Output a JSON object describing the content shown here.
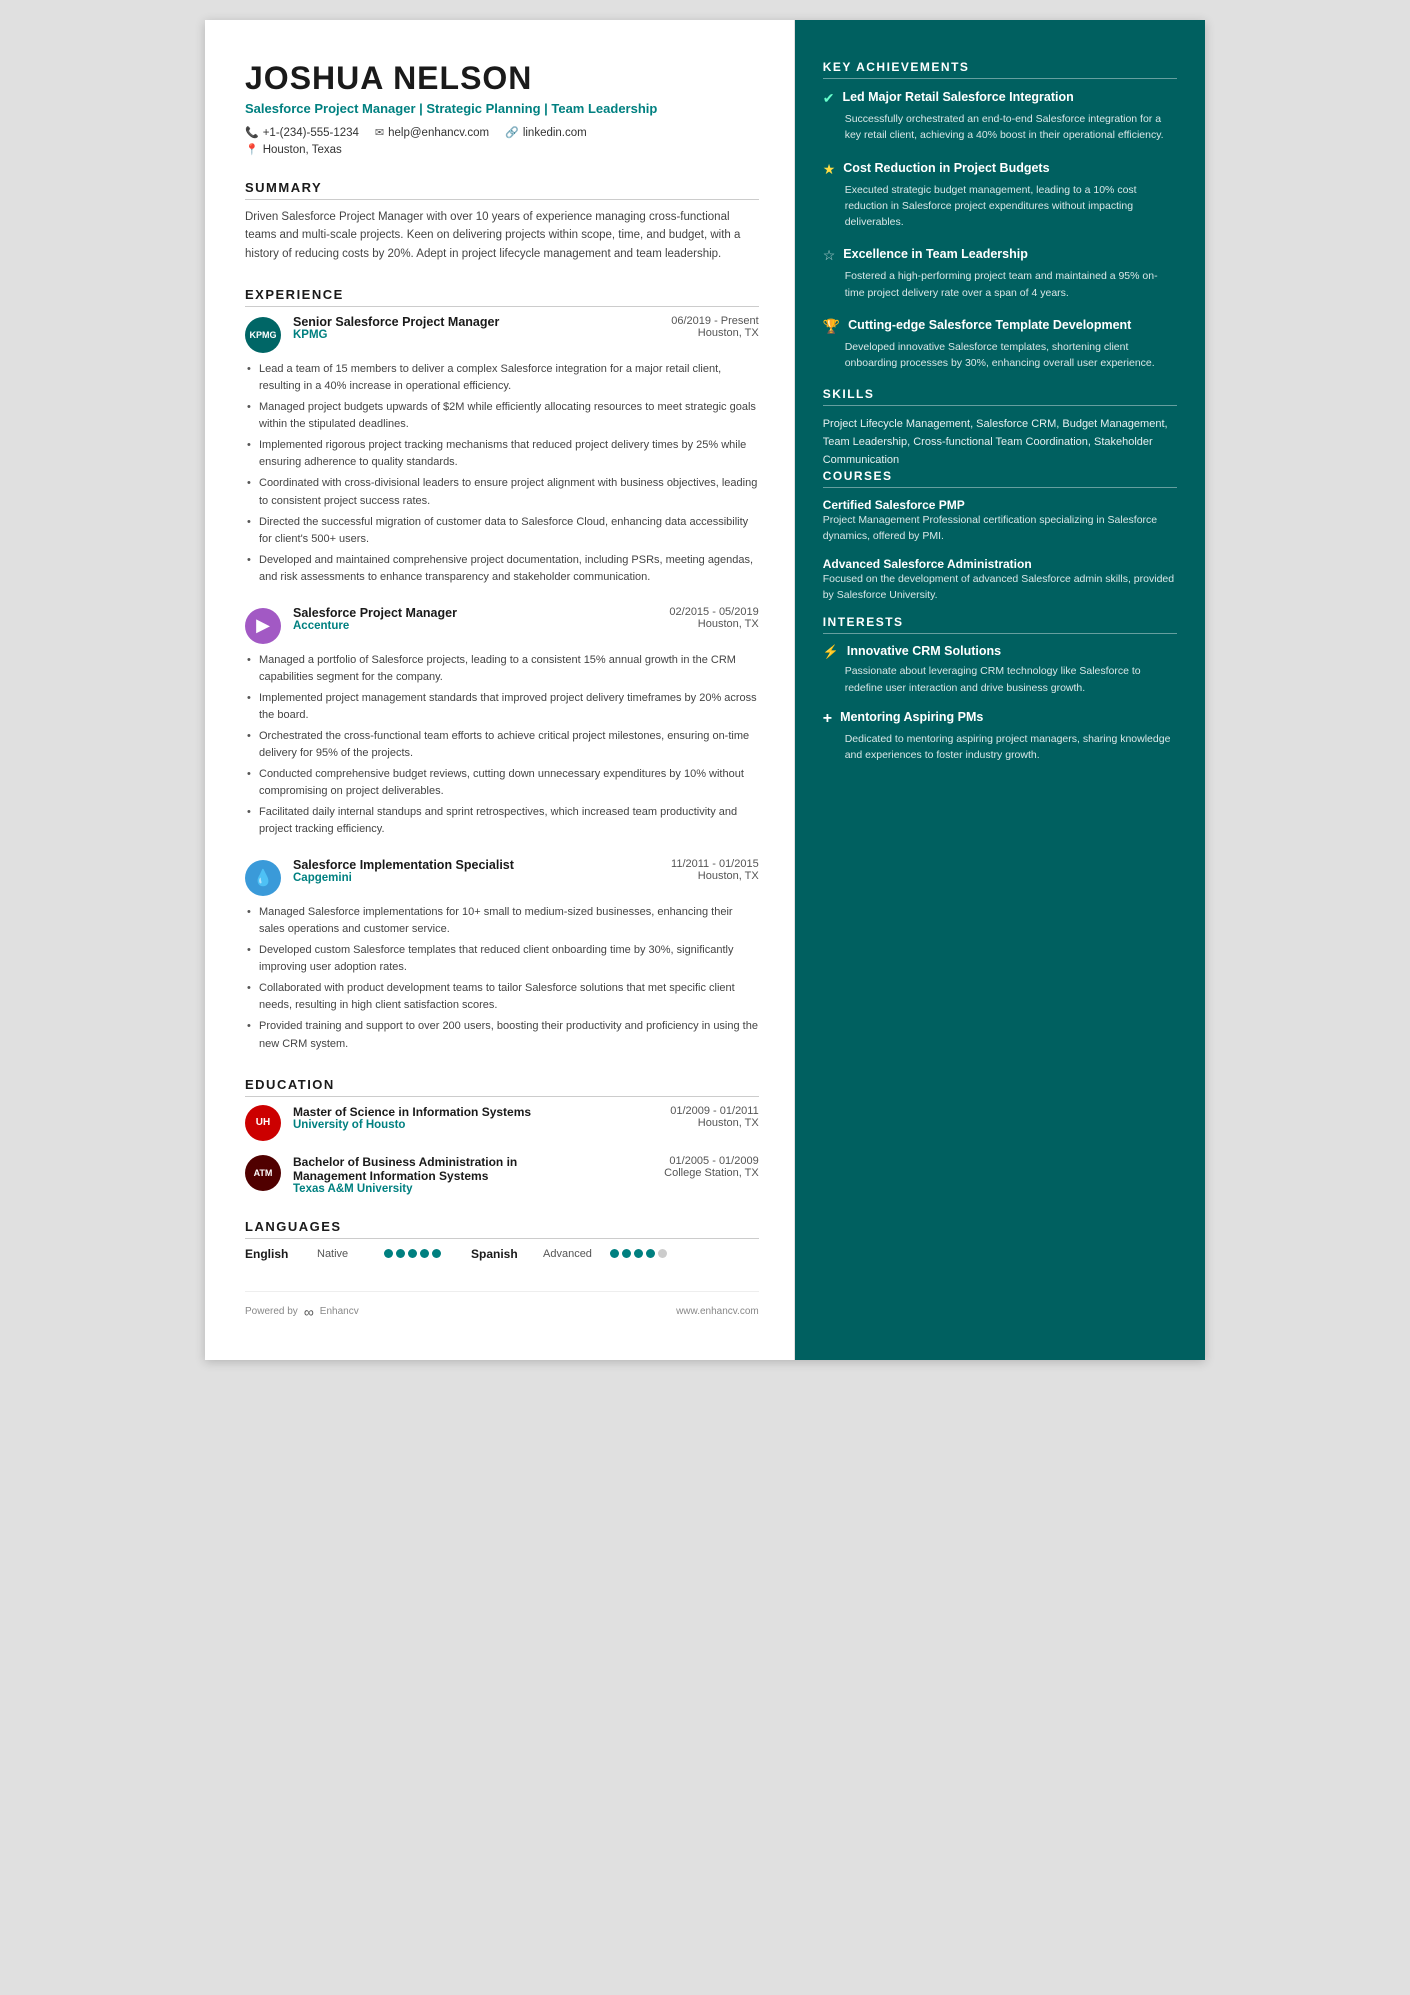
{
  "header": {
    "name": "JOSHUA NELSON",
    "title": "Salesforce Project Manager | Strategic Planning | Team Leadership",
    "phone": "+1-(234)-555-1234",
    "email": "help@enhancv.com",
    "linkedin": "linkedin.com",
    "location": "Houston, Texas"
  },
  "summary": {
    "title": "SUMMARY",
    "text": "Driven Salesforce Project Manager with over 10 years of experience managing cross-functional teams and multi-scale projects. Keen on delivering projects within scope, time, and budget, with a history of reducing costs by 20%. Adept in project lifecycle management and team leadership."
  },
  "experience": {
    "title": "EXPERIENCE",
    "items": [
      {
        "logo_text": "KPMG",
        "logo_class": "kpmg-logo",
        "title": "Senior Salesforce Project Manager",
        "company": "KPMG",
        "date": "06/2019 - Present",
        "location": "Houston, TX",
        "bullets": [
          "Lead a team of 15 members to deliver a complex Salesforce integration for a major retail client, resulting in a 40% increase in operational efficiency.",
          "Managed project budgets upwards of $2M while efficiently allocating resources to meet strategic goals within the stipulated deadlines.",
          "Implemented rigorous project tracking mechanisms that reduced project delivery times by 25% while ensuring adherence to quality standards.",
          "Coordinated with cross-divisional leaders to ensure project alignment with business objectives, leading to consistent project success rates.",
          "Directed the successful migration of customer data to Salesforce Cloud, enhancing data accessibility for client's 500+ users.",
          "Developed and maintained comprehensive project documentation, including PSRs, meeting agendas, and risk assessments to enhance transparency and stakeholder communication."
        ]
      },
      {
        "logo_text": "▶",
        "logo_class": "accenture-logo",
        "title": "Salesforce Project Manager",
        "company": "Accenture",
        "date": "02/2015 - 05/2019",
        "location": "Houston, TX",
        "bullets": [
          "Managed a portfolio of Salesforce projects, leading to a consistent 15% annual growth in the CRM capabilities segment for the company.",
          "Implemented project management standards that improved project delivery timeframes by 20% across the board.",
          "Orchestrated the cross-functional team efforts to achieve critical project milestones, ensuring on-time delivery for 95% of the projects.",
          "Conducted comprehensive budget reviews, cutting down unnecessary expenditures by 10% without compromising on project deliverables.",
          "Facilitated daily internal standups and sprint retrospectives, which increased team productivity and project tracking efficiency."
        ]
      },
      {
        "logo_text": "◆",
        "logo_class": "capgemini-logo",
        "title": "Salesforce Implementation Specialist",
        "company": "Capgemini",
        "date": "11/2011 - 01/2015",
        "location": "Houston, TX",
        "bullets": [
          "Managed Salesforce implementations for 10+ small to medium-sized businesses, enhancing their sales operations and customer service.",
          "Developed custom Salesforce templates that reduced client onboarding time by 30%, significantly improving user adoption rates.",
          "Collaborated with product development teams to tailor Salesforce solutions that met specific client needs, resulting in high client satisfaction scores.",
          "Provided training and support to over 200 users, boosting their productivity and proficiency in using the new CRM system."
        ]
      }
    ]
  },
  "education": {
    "title": "EDUCATION",
    "items": [
      {
        "logo_text": "UH",
        "logo_class": "uh-logo",
        "degree": "Master of Science in Information Systems",
        "school": "University of Housto",
        "date": "01/2009 - 01/2011",
        "location": "Houston, TX"
      },
      {
        "logo_text": "ATM",
        "logo_class": "tamu-logo",
        "degree": "Bachelor of Business Administration in Management Information Systems",
        "school": "Texas A&M University",
        "date": "01/2005 - 01/2009",
        "location": "College Station, TX"
      }
    ]
  },
  "languages": {
    "title": "LANGUAGES",
    "items": [
      {
        "name": "English",
        "level": "Native",
        "dots": [
          true,
          true,
          true,
          true,
          true
        ]
      },
      {
        "name": "Spanish",
        "level": "Advanced",
        "dots": [
          true,
          true,
          true,
          true,
          false
        ]
      }
    ]
  },
  "footer": {
    "powered_by": "Powered by",
    "brand": "Enhancv",
    "website": "www.enhancv.com"
  },
  "key_achievements": {
    "title": "KEY ACHIEVEMENTS",
    "items": [
      {
        "icon": "✔",
        "icon_class": "check",
        "title": "Led Major Retail Salesforce Integration",
        "desc": "Successfully orchestrated an end-to-end Salesforce integration for a key retail client, achieving a 40% boost in their operational efficiency."
      },
      {
        "icon": "★",
        "icon_class": "star-filled",
        "title": "Cost Reduction in Project Budgets",
        "desc": "Executed strategic budget management, leading to a 10% cost reduction in Salesforce project expenditures without impacting deliverables."
      },
      {
        "icon": "☆",
        "icon_class": "star-empty",
        "title": "Excellence in Team Leadership",
        "desc": "Fostered a high-performing project team and maintained a 95% on-time project delivery rate over a span of 4 years."
      },
      {
        "icon": "🏆",
        "icon_class": "trophy",
        "title": "Cutting-edge Salesforce Template Development",
        "desc": "Developed innovative Salesforce templates, shortening client onboarding processes by 30%, enhancing overall user experience."
      }
    ]
  },
  "skills": {
    "title": "SKILLS",
    "text": "Project Lifecycle Management, Salesforce CRM, Budget Management, Team Leadership, Cross-functional Team Coordination, Stakeholder Communication"
  },
  "courses": {
    "title": "COURSES",
    "items": [
      {
        "title": "Certified Salesforce PMP",
        "desc": "Project Management Professional certification specializing in Salesforce dynamics, offered by PMI."
      },
      {
        "title": "Advanced Salesforce Administration",
        "desc": "Focused on the development of advanced Salesforce admin skills, provided by Salesforce University."
      }
    ]
  },
  "interests": {
    "title": "INTERESTS",
    "items": [
      {
        "icon": "⚡",
        "title": "Innovative CRM Solutions",
        "desc": "Passionate about leveraging CRM technology like Salesforce to redefine user interaction and drive business growth."
      },
      {
        "icon": "+",
        "title": "Mentoring Aspiring PMs",
        "desc": "Dedicated to mentoring aspiring project managers, sharing knowledge and experiences to foster industry growth."
      }
    ]
  }
}
